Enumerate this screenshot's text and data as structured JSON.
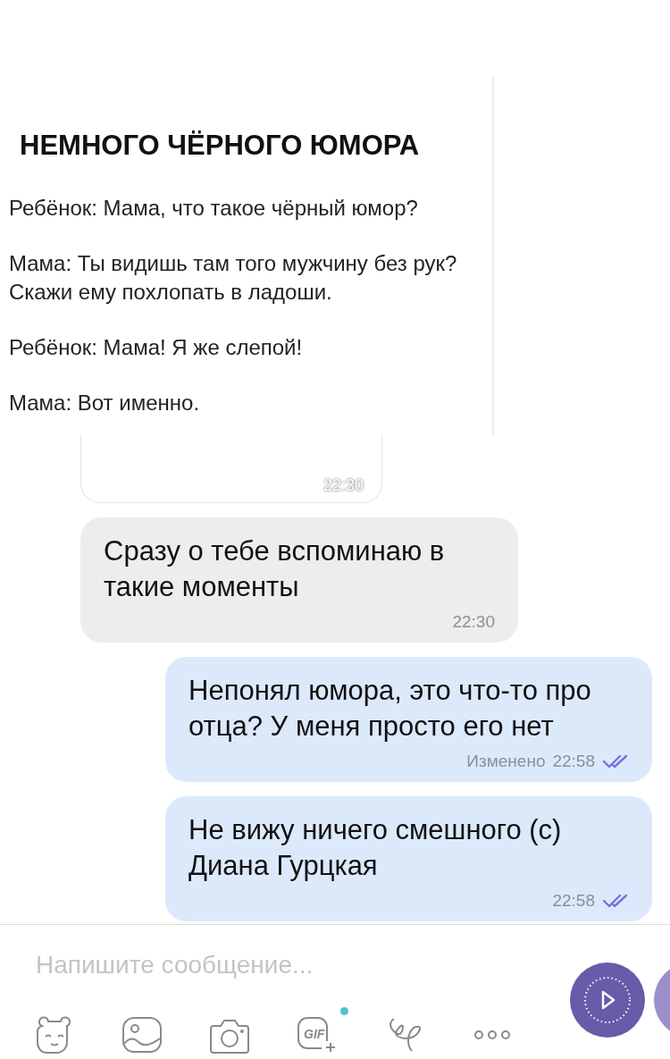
{
  "messages": [
    {
      "kind": "image",
      "document": {
        "title": "НЕМНОГО ЧЁРНОГО ЮМОРА",
        "paragraphs": [
          "Ребёнок: Мама, что такое чёрный юмор?",
          "Мама: Ты видишь там того мужчину без рук? Скажи ему похлопать в ладоши.",
          "Ребёнок: Мама! Я же слепой!",
          "Мама: Вот именно."
        ]
      },
      "time": "22:30"
    },
    {
      "kind": "incoming",
      "text": "Сразу о тебе вспоминаю в такие моменты",
      "time": "22:30"
    },
    {
      "kind": "outgoing",
      "text": "Непонял юмора, это что-то про отца? У меня просто его нет",
      "edited": "Изменено",
      "time": "22:58",
      "read": true
    },
    {
      "kind": "outgoing",
      "text": "Не вижу ничего смешного (с) Диана Гурцкая",
      "time": "22:58",
      "read": true
    }
  ],
  "composer": {
    "placeholder": "Напишите сообщение...",
    "gif_label": "GIF",
    "gif_new": true
  }
}
